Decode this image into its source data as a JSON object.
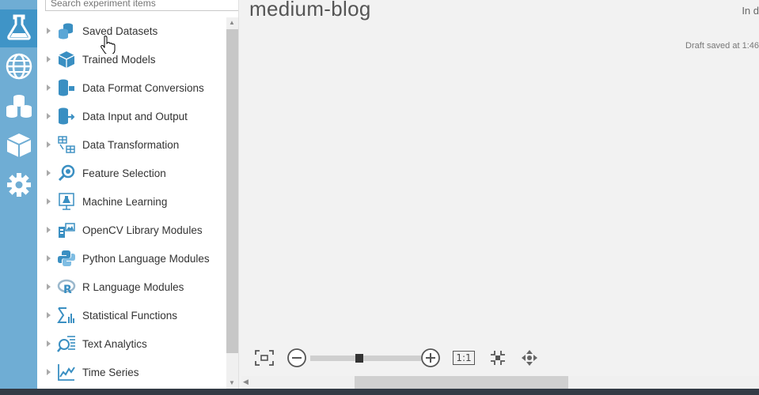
{
  "rail": {
    "items": [
      {
        "name": "experiments",
        "icon": "flask-icon",
        "active": true
      },
      {
        "name": "web-services",
        "icon": "globe-icon",
        "active": false
      },
      {
        "name": "datasets",
        "icon": "datasets-icon",
        "active": false
      },
      {
        "name": "trained-models",
        "icon": "cube-icon",
        "active": false
      },
      {
        "name": "settings",
        "icon": "gear-icon",
        "active": false
      }
    ]
  },
  "palette": {
    "search_placeholder": "Search experiment items",
    "items": [
      {
        "label": "Saved Datasets",
        "icon": "datasets-icon"
      },
      {
        "label": "Trained Models",
        "icon": "cube-icon"
      },
      {
        "label": "Data Format Conversions",
        "icon": "data-format-conversion-icon"
      },
      {
        "label": "Data Input and Output",
        "icon": "data-input-output-icon"
      },
      {
        "label": "Data Transformation",
        "icon": "data-transformation-icon"
      },
      {
        "label": "Feature Selection",
        "icon": "feature-selection-icon"
      },
      {
        "label": "Machine Learning",
        "icon": "machine-learning-icon"
      },
      {
        "label": "OpenCV Library Modules",
        "icon": "opencv-icon"
      },
      {
        "label": "Python Language Modules",
        "icon": "python-icon"
      },
      {
        "label": "R Language Modules",
        "icon": "r-language-icon"
      },
      {
        "label": "Statistical Functions",
        "icon": "statistical-functions-icon"
      },
      {
        "label": "Text Analytics",
        "icon": "text-analytics-icon"
      },
      {
        "label": "Time Series",
        "icon": "time-series-icon"
      }
    ]
  },
  "canvas": {
    "title": "medium-blog",
    "status": "In d",
    "draft_saved": "Draft saved at 1:46"
  },
  "zoom": {
    "one_to_one_label": "1:1",
    "level": 0.44
  },
  "colors": {
    "rail": "#6fadd4",
    "rail_active": "#3f94c7",
    "icon_blue": "#3a8fc2",
    "canvas_bg": "#f2f2f2"
  }
}
